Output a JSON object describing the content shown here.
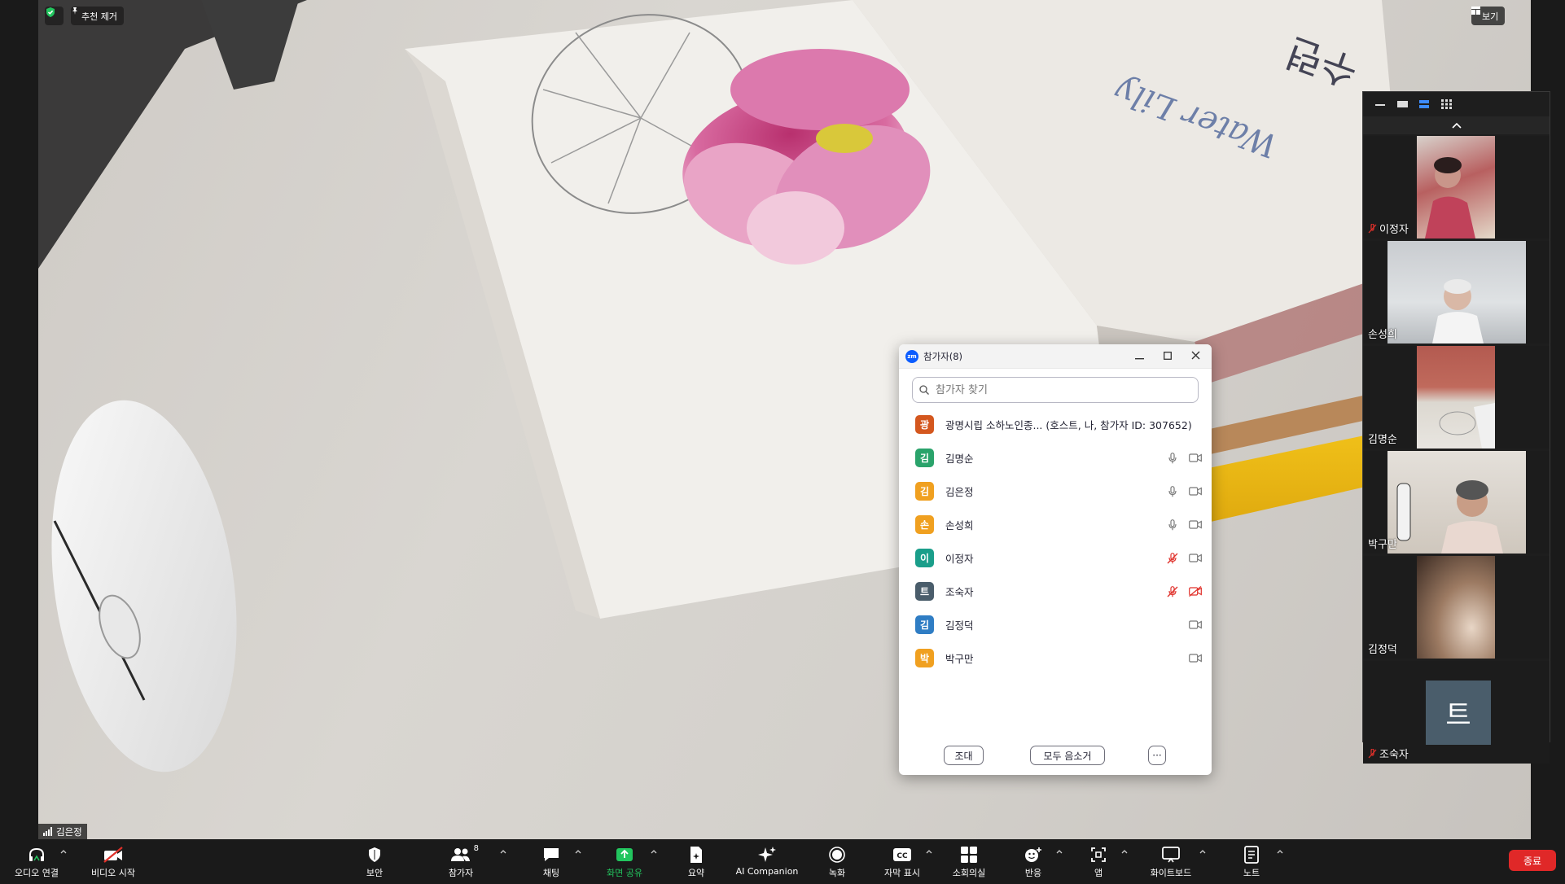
{
  "main_video": {
    "recommend_remove_label": "추천 제거",
    "view_label": "보기",
    "speaker_name": "김은정"
  },
  "gallery": {
    "tiles": [
      {
        "name": "이정자",
        "muted": true
      },
      {
        "name": "손성희",
        "muted": false
      },
      {
        "name": "김명순",
        "muted": false
      },
      {
        "name": "박구만",
        "muted": false
      },
      {
        "name": "김정덕",
        "muted": false
      },
      {
        "name": "조숙자",
        "muted": true,
        "avatar_letter": "트"
      }
    ]
  },
  "participants_panel": {
    "logo_text": "zm",
    "title": "참가자(8)",
    "search_placeholder": "참가자 찾기",
    "participants": [
      {
        "initial": "광",
        "name": "광명시립 소하노인종... (호스트, 나, 참가자 ID: 307652)",
        "color": "#d4571e",
        "mic": "none",
        "video": "none"
      },
      {
        "initial": "김",
        "name": "김명순",
        "color": "#2aa36b",
        "mic": "on",
        "video": "on"
      },
      {
        "initial": "김",
        "name": "김은정",
        "color": "#f0a020",
        "mic": "on",
        "video": "on"
      },
      {
        "initial": "손",
        "name": "손성희",
        "color": "#f0a020",
        "mic": "on",
        "video": "on"
      },
      {
        "initial": "이",
        "name": "이정자",
        "color": "#1a9e8a",
        "mic": "muted",
        "video": "on"
      },
      {
        "initial": "트",
        "name": "조숙자",
        "color": "#4a5d6b",
        "mic": "muted",
        "video": "off"
      },
      {
        "initial": "김",
        "name": "김정덕",
        "color": "#2f7dc4",
        "mic": "none",
        "video": "on"
      },
      {
        "initial": "박",
        "name": "박구만",
        "color": "#f0a020",
        "mic": "none",
        "video": "on"
      }
    ],
    "invite_label": "조대",
    "mute_all_label": "모두 음소거",
    "more_label": "···"
  },
  "toolbar": {
    "audio_label": "오디오 연결",
    "video_label": "비디오 시작",
    "security_label": "보안",
    "participants_label": "참가자",
    "participants_count": "8",
    "chat_label": "채팅",
    "share_label": "화면 공유",
    "summary_label": "요약",
    "ai_label": "AI Companion",
    "record_label": "녹화",
    "cc_label": "자막 표시",
    "breakout_label": "소회의실",
    "reaction_label": "반응",
    "apps_label": "앱",
    "whiteboard_label": "화이트보드",
    "notes_label": "노트",
    "end_label": "종료"
  },
  "colors": {
    "share_green": "#22c55e",
    "end_red": "#e02828",
    "muted_red": "#e0302a"
  }
}
